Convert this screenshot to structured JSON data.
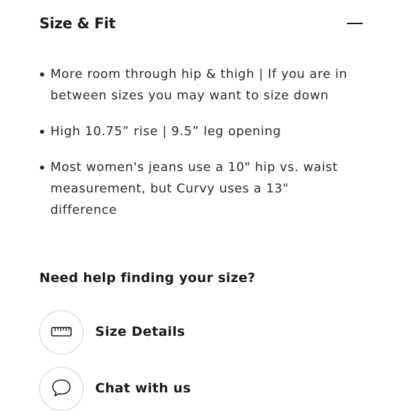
{
  "section": {
    "title": "Size & Fit",
    "toggle_icon": "minus-icon"
  },
  "bullets": [
    "More room through hip & thigh | If you are in between sizes you may want to size down",
    "High 10.75” rise | 9.5” leg opening",
    "Most women's jeans use a 10\" hip vs. waist measurement, but Curvy uses a 13\" difference"
  ],
  "help": {
    "heading": "Need help finding your size?",
    "options": [
      {
        "label": "Size Details",
        "icon": "ruler-icon"
      },
      {
        "label": "Chat with us",
        "icon": "chat-bubble-icon"
      }
    ]
  }
}
